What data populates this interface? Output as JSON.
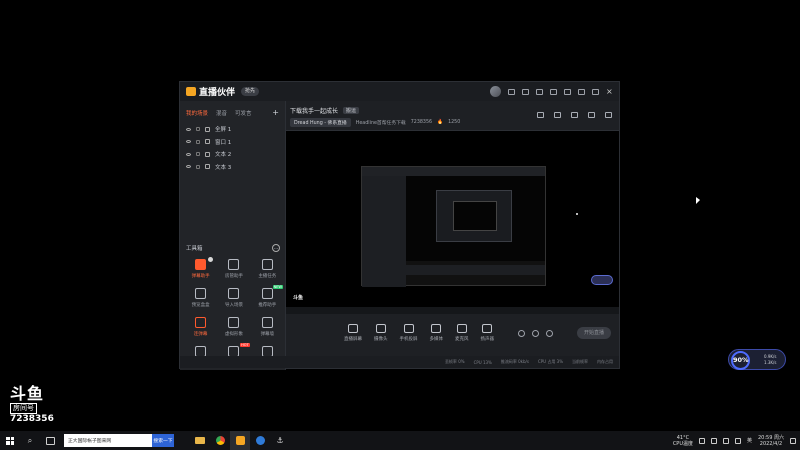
{
  "app": {
    "name": "直播伙伴",
    "version_button": "抢先",
    "left_tabs": [
      "我的场景",
      "混音",
      "可发言"
    ],
    "scenes": [
      {
        "label": "全屏 1"
      },
      {
        "label": "窗口 1"
      },
      {
        "label": "文本 2"
      },
      {
        "label": "文本 3"
      }
    ],
    "tools_title": "工具箱",
    "tools_more": "…",
    "tools": [
      {
        "label": "弹幕助手",
        "style": "red",
        "badge": "dot"
      },
      {
        "label": "房管助手",
        "style": "normal",
        "badge": ""
      },
      {
        "label": "主播任务",
        "style": "normal",
        "badge": ""
      },
      {
        "label": "预览盒盒",
        "style": "normal",
        "badge": ""
      },
      {
        "label": "导入场景",
        "style": "normal",
        "badge": ""
      },
      {
        "label": "推荐助手",
        "style": "normal",
        "badge": "new"
      },
      {
        "label": "连弹幕",
        "style": "redo",
        "badge": ""
      },
      {
        "label": "虚拟形象",
        "style": "normal",
        "badge": ""
      },
      {
        "label": "弹幕墙",
        "style": "normal",
        "badge": ""
      },
      {
        "label": "",
        "style": "normal",
        "badge": ""
      },
      {
        "label": "",
        "style": "normal",
        "badge": "hot"
      },
      {
        "label": "",
        "style": "normal",
        "badge": ""
      }
    ],
    "room": {
      "title": "下载我手一起成长",
      "category_tag": "搬运",
      "anchor_chip": "Dread Hung - 佛系直播",
      "subtitle_text": "Headline首帮任务下载",
      "room_id": "7238356",
      "popularity": "1250"
    },
    "controls": [
      {
        "label": "直播屏幕"
      },
      {
        "label": "摄像头"
      },
      {
        "label": "手机投屏"
      },
      {
        "label": "多媒体"
      },
      {
        "label": "麦克风"
      },
      {
        "label": "扬声器"
      }
    ],
    "start_live_button": "开始直播",
    "status_items": [
      "丢帧率 0%",
      "CPU 13%",
      "推流码率 0kb/s",
      "CPU 占用 3%",
      "当前帧率",
      "内存占用"
    ]
  },
  "desktop": {
    "net_widget": {
      "value": "90%",
      "up": "0.9K/s",
      "down": "1.3K/s"
    },
    "watermark": {
      "logo": "斗鱼",
      "room_label": "房间号",
      "room_number": "7238356"
    }
  },
  "taskbar": {
    "search_text": "正大国际帐子图来网",
    "search_button": "搜索一下",
    "weather_temp": "41°C",
    "weather_label": "CPU温度",
    "lang": "英",
    "time": "20:59 周六",
    "date": "2022/4/2"
  },
  "colors": {
    "accent": "#ff6a3d",
    "panel": "#1e2024",
    "taskbar": "#121316"
  }
}
